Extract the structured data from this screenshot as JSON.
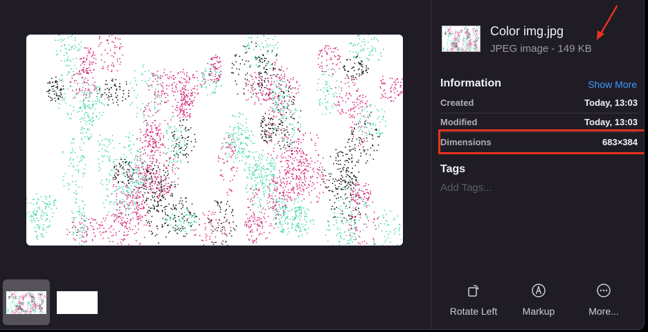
{
  "file": {
    "name": "Color img.jpg",
    "kind": "JPEG image - 149 KB"
  },
  "information": {
    "title": "Information",
    "show_more": "Show More",
    "rows": [
      {
        "key": "Created",
        "value": "Today, 13:03"
      },
      {
        "key": "Modified",
        "value": "Today, 13:03"
      },
      {
        "key": "Dimensions",
        "value": "683×384"
      }
    ]
  },
  "tags": {
    "title": "Tags",
    "placeholder": "Add Tags..."
  },
  "toolbar": {
    "rotate_left": "Rotate Left",
    "markup": "Markup",
    "more": "More..."
  },
  "icons": {
    "rotate": "rotate-left-icon",
    "markup": "markup-pen-icon",
    "more": "ellipsis-circle-icon",
    "arrow": "red-annotation-arrow-icon"
  },
  "colors": {
    "background": "#1f1c26",
    "accent": "#3f9bff",
    "highlight": "#e8321e",
    "dot_pink": "#d6257a",
    "dot_teal": "#3fd6a8",
    "dot_black": "#111111"
  }
}
